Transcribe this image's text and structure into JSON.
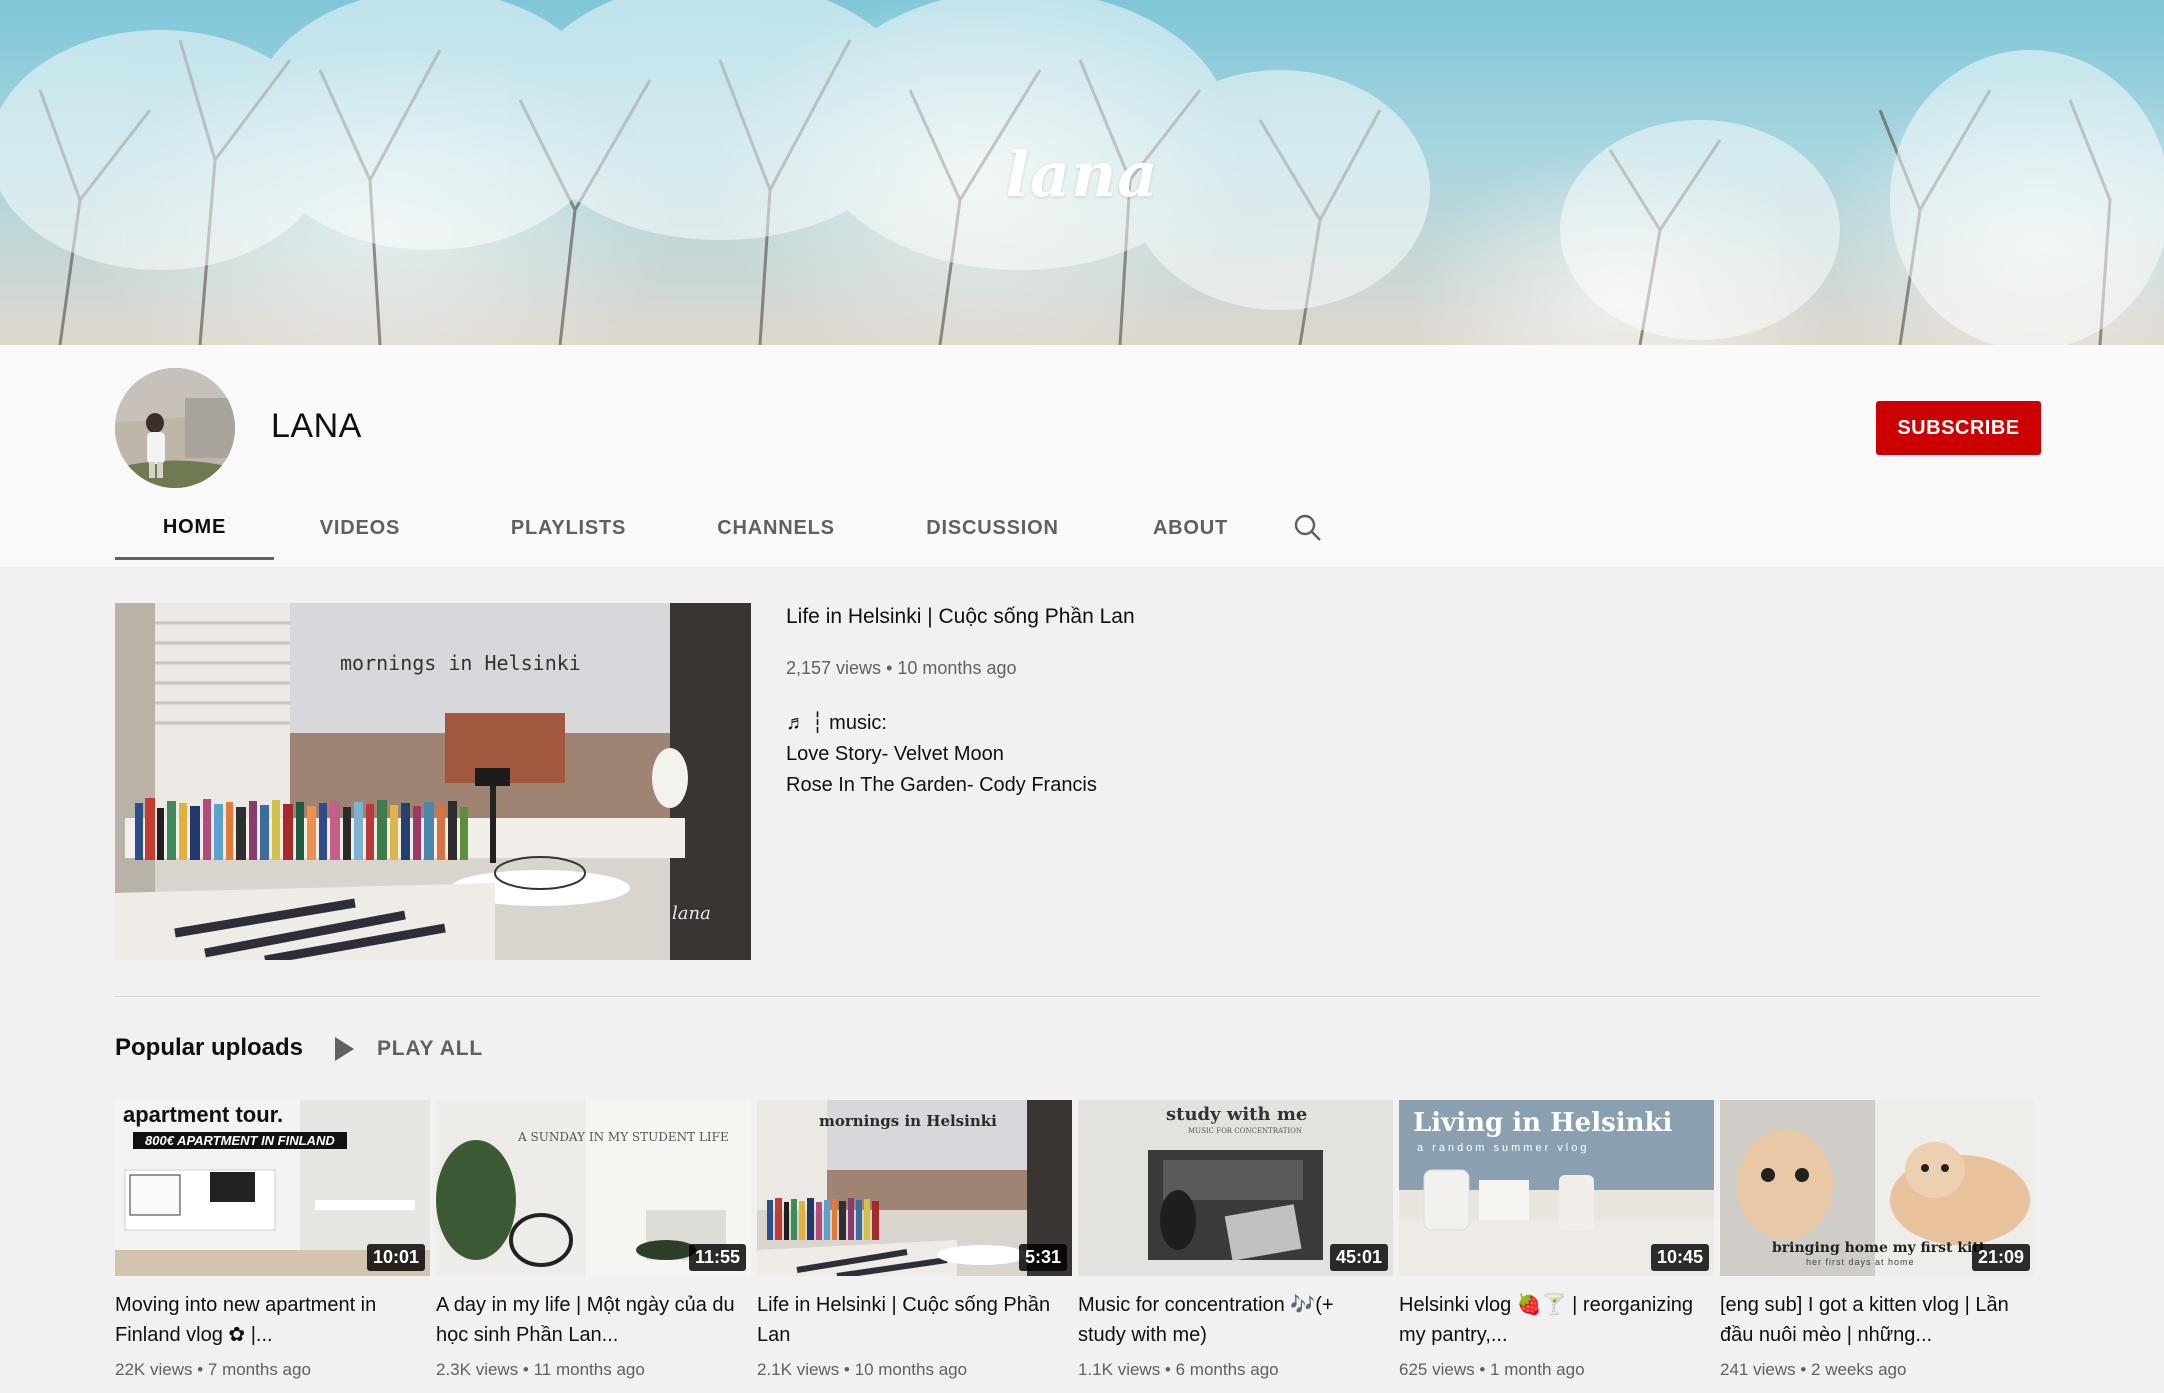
{
  "banner": {
    "text": "lana"
  },
  "channel": {
    "name": "LANA",
    "subscribe_label": "SUBSCRIBE"
  },
  "tabs": [
    {
      "label": "HOME",
      "active": true
    },
    {
      "label": "VIDEOS"
    },
    {
      "label": "PLAYLISTS"
    },
    {
      "label": "CHANNELS"
    },
    {
      "label": "DISCUSSION"
    },
    {
      "label": "ABOUT"
    }
  ],
  "search_icon": "search-icon",
  "featured": {
    "thumb_caption": "mornings in Helsinki",
    "watermark": "lana",
    "title": "Life in Helsinki | Cuộc sống Phần Lan",
    "views": "2,157 views",
    "age": "10 months ago",
    "desc_line1": "♬ ┆ music:",
    "desc_line2": "Love Story- Velvet Moon",
    "desc_line3": "Rose In The Garden- Cody Francis"
  },
  "popular": {
    "title": "Popular uploads",
    "play_all": "PLAY ALL",
    "videos": [
      {
        "title": "Moving into new apartment in Finland vlog ✿ |...",
        "views": "22K views",
        "age": "7 months ago",
        "duration": "10:01",
        "caption": "apartment tour.",
        "subcaption": "800€ APARTMENT IN FINLAND"
      },
      {
        "title": "A day in my life | Một ngày của du học sinh Phần Lan...",
        "views": "2.3K views",
        "age": "11 months ago",
        "duration": "11:55",
        "caption": "A SUNDAY IN MY STUDENT LIFE"
      },
      {
        "title": "Life in Helsinki | Cuộc sống Phần Lan",
        "views": "2.1K views",
        "age": "10 months ago",
        "duration": "5:31",
        "caption": "mornings in Helsinki"
      },
      {
        "title": "Music for concentration 🎶(+ study with me)",
        "views": "1.1K views",
        "age": "6 months ago",
        "duration": "45:01",
        "caption": "study with me",
        "subcaption": "MUSIC FOR CONCENTRATION"
      },
      {
        "title": "Helsinki vlog 🍓🍸 | reorganizing my pantry,...",
        "views": "625 views",
        "age": "1 month ago",
        "duration": "10:45",
        "caption": "Living in Helsinki",
        "subcaption": "a random summer vlog"
      },
      {
        "title": "[eng sub] I got a kitten vlog | Lần đầu nuôi mèo | những...",
        "views": "241 views",
        "age": "2 weeks ago",
        "duration": "21:09",
        "caption": "bringing home my first kitt",
        "subcaption": "her first days at home"
      }
    ]
  },
  "colors": {
    "accent": "#cc0000",
    "muted": "#606060",
    "page_bg": "#f1f1f1",
    "header_bg": "#f9f9f9"
  }
}
